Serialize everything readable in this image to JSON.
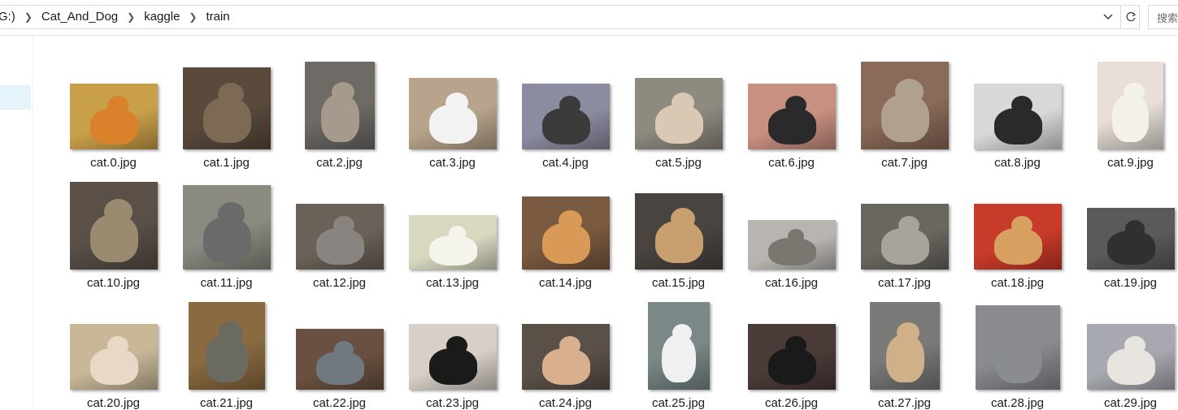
{
  "breadcrumb": {
    "drive_fragment": "G:)",
    "items": [
      "Cat_And_Dog",
      "kaggle",
      "train"
    ]
  },
  "address_dropdown_icon": "chevron-down-icon",
  "refresh_icon": "refresh-icon",
  "search": {
    "placeholder": "搜索"
  },
  "files": [
    {
      "name": "cat.0.jpg",
      "bg": "#c9a04a",
      "cat": "#d9822b"
    },
    {
      "name": "cat.1.jpg",
      "bg": "#5a4a3c",
      "cat": "#7d6a55"
    },
    {
      "name": "cat.2.jpg",
      "bg": "#6f6a66",
      "cat": "#a59a8c"
    },
    {
      "name": "cat.3.jpg",
      "bg": "#b8a48c",
      "cat": "#f2f2f2"
    },
    {
      "name": "cat.4.jpg",
      "bg": "#8c8ca0",
      "cat": "#3b3b3b"
    },
    {
      "name": "cat.5.jpg",
      "bg": "#8f8a80",
      "cat": "#d8c8b4"
    },
    {
      "name": "cat.6.jpg",
      "bg": "#c89080",
      "cat": "#2a2a2a"
    },
    {
      "name": "cat.7.jpg",
      "bg": "#8a6a58",
      "cat": "#b0a090"
    },
    {
      "name": "cat.8.jpg",
      "bg": "#d8d8d8",
      "cat": "#2a2a2a"
    },
    {
      "name": "cat.9.jpg",
      "bg": "#e8e0d8",
      "cat": "#f4f0ea"
    },
    {
      "name": "cat.10.jpg",
      "bg": "#5a5048",
      "cat": "#9a8a70"
    },
    {
      "name": "cat.11.jpg",
      "bg": "#8a8a80",
      "cat": "#6a6a6a"
    },
    {
      "name": "cat.12.jpg",
      "bg": "#6a6258",
      "cat": "#8a8480"
    },
    {
      "name": "cat.13.jpg",
      "bg": "#d8d8c0",
      "cat": "#f4f4ec"
    },
    {
      "name": "cat.14.jpg",
      "bg": "#7a5a40",
      "cat": "#d99a58"
    },
    {
      "name": "cat.15.jpg",
      "bg": "#4a4440",
      "cat": "#c8a070"
    },
    {
      "name": "cat.16.jpg",
      "bg": "#b8b4b0",
      "cat": "#7a7670"
    },
    {
      "name": "cat.17.jpg",
      "bg": "#6a6660",
      "cat": "#a8a49c"
    },
    {
      "name": "cat.18.jpg",
      "bg": "#c83a2a",
      "cat": "#d8a060"
    },
    {
      "name": "cat.19.jpg",
      "bg": "#5a5a5a",
      "cat": "#303030"
    },
    {
      "name": "cat.20.jpg",
      "bg": "#c8b898",
      "cat": "#e8d8c8"
    },
    {
      "name": "cat.21.jpg",
      "bg": "#8a6a40",
      "cat": "#6a6a60"
    },
    {
      "name": "cat.22.jpg",
      "bg": "#6a5040",
      "cat": "#707880"
    },
    {
      "name": "cat.23.jpg",
      "bg": "#d8d0c8",
      "cat": "#1a1a1a"
    },
    {
      "name": "cat.24.jpg",
      "bg": "#5a5048",
      "cat": "#d8b090"
    },
    {
      "name": "cat.25.jpg",
      "bg": "#7a8888",
      "cat": "#f0f0f0"
    },
    {
      "name": "cat.26.jpg",
      "bg": "#4a3a38",
      "cat": "#1a1a1a"
    },
    {
      "name": "cat.27.jpg",
      "bg": "#7a7a78",
      "cat": "#d0b088"
    },
    {
      "name": "cat.28.jpg",
      "bg": "#8a8a90",
      "cat": "#8a8c90"
    },
    {
      "name": "cat.29.jpg",
      "bg": "#a8a8b0",
      "cat": "#e8e4e0"
    }
  ]
}
